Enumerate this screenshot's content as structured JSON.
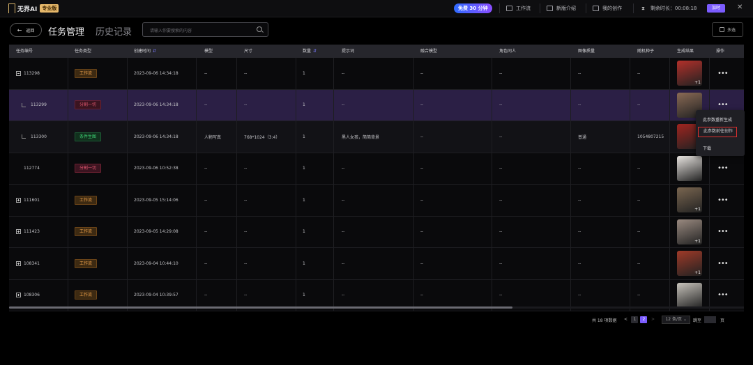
{
  "topbar": {
    "logo_text": "无界AI",
    "pro_badge": "专业版",
    "free_label": "免费 30 分钟",
    "nav": [
      {
        "label": "工作流",
        "icon": "workflow-icon"
      },
      {
        "label": "新版介绍",
        "icon": "new-icon"
      },
      {
        "label": "我的创作",
        "icon": "image-icon"
      }
    ],
    "remain_label": "剩余时长：00:08:18",
    "recharge_label": "加时",
    "close": "✕"
  },
  "header": {
    "back_label": "返回",
    "tab_active": "任务管理",
    "tab_inactive": "历史记录",
    "search_placeholder": "请输入你要搜索的内容",
    "multi_select_label": "多选"
  },
  "table": {
    "columns": [
      "任务编号",
      "任务类型",
      "创建时间",
      "模型",
      "尺寸",
      "数量",
      "提示词",
      "融合模型",
      "角色同人",
      "图像质量",
      "随机种子",
      "生成结果",
      "操作"
    ],
    "rows": [
      {
        "id": "113298",
        "expander": "minus",
        "type": "工作流",
        "type_style": "wf",
        "time": "2023-09-06 14:34:18",
        "model": "--",
        "size": "--",
        "qty": "1",
        "prompt": "--",
        "fusion": "--",
        "role": "--",
        "quality": "--",
        "seed": "--",
        "thumb_count": "+1",
        "row_style": "normal"
      },
      {
        "id": "113299",
        "expander": "child",
        "type": "分割一切",
        "type_style": "split",
        "time": "2023-09-06 14:34:18",
        "model": "--",
        "size": "--",
        "qty": "1",
        "prompt": "--",
        "fusion": "--",
        "role": "--",
        "quality": "--",
        "seed": "--",
        "thumb_count": "",
        "row_style": "sel"
      },
      {
        "id": "113300",
        "expander": "child",
        "type": "条件生图",
        "type_style": "cond",
        "time": "2023-09-06 14:34:18",
        "model": "人物写真",
        "size": "768*1024（3:4）",
        "qty": "1",
        "prompt": "黑人女孩，简简背景",
        "fusion": "--",
        "role": "--",
        "quality": "普通",
        "seed": "1054807215",
        "thumb_count": "",
        "row_style": "alt"
      },
      {
        "id": "112774",
        "expander": "none",
        "type": "分割一切",
        "type_style": "split",
        "time": "2023-09-06 10:52:38",
        "model": "--",
        "size": "--",
        "qty": "1",
        "prompt": "--",
        "fusion": "--",
        "role": "--",
        "quality": "--",
        "seed": "--",
        "thumb_count": "",
        "row_style": "normal"
      },
      {
        "id": "111601",
        "expander": "plus",
        "type": "工作流",
        "type_style": "wf",
        "time": "2023-09-05 15:14:06",
        "model": "--",
        "size": "--",
        "qty": "1",
        "prompt": "--",
        "fusion": "--",
        "role": "--",
        "quality": "--",
        "seed": "--",
        "thumb_count": "+1",
        "row_style": "normal"
      },
      {
        "id": "111423",
        "expander": "plus",
        "type": "工作流",
        "type_style": "wf",
        "time": "2023-09-05 14:29:08",
        "model": "--",
        "size": "--",
        "qty": "1",
        "prompt": "--",
        "fusion": "--",
        "role": "--",
        "quality": "--",
        "seed": "--",
        "thumb_count": "+1",
        "row_style": "normal"
      },
      {
        "id": "108341",
        "expander": "plus",
        "type": "工作流",
        "type_style": "wf",
        "time": "2023-09-04 10:44:10",
        "model": "--",
        "size": "--",
        "qty": "1",
        "prompt": "--",
        "fusion": "--",
        "role": "--",
        "quality": "--",
        "seed": "--",
        "thumb_count": "+1",
        "row_style": "normal"
      },
      {
        "id": "108306",
        "expander": "plus",
        "type": "工作流",
        "type_style": "wf",
        "time": "2023-09-04 10:39:57",
        "model": "--",
        "size": "--",
        "qty": "1",
        "prompt": "--",
        "fusion": "--",
        "role": "--",
        "quality": "--",
        "seed": "--",
        "thumb_count": "",
        "row_style": "normal"
      }
    ],
    "thumb_colors": [
      "#b3302a",
      "#8a6a55",
      "#a0241f",
      "#e8e4e0",
      "#7a6650",
      "#9a8a80",
      "#a03a28",
      "#c8c4bc"
    ]
  },
  "context_menu": {
    "items": [
      "此参数重新生成",
      "此参数前往创作",
      "下载"
    ],
    "highlight_index": 1
  },
  "pagination": {
    "total_label": "共 18 项数据",
    "prev": "<",
    "pages": [
      "1",
      "2"
    ],
    "current": "2",
    "next": ">",
    "page_size": "12 条/页",
    "goto_label": "跳至",
    "page_suffix": "页"
  }
}
